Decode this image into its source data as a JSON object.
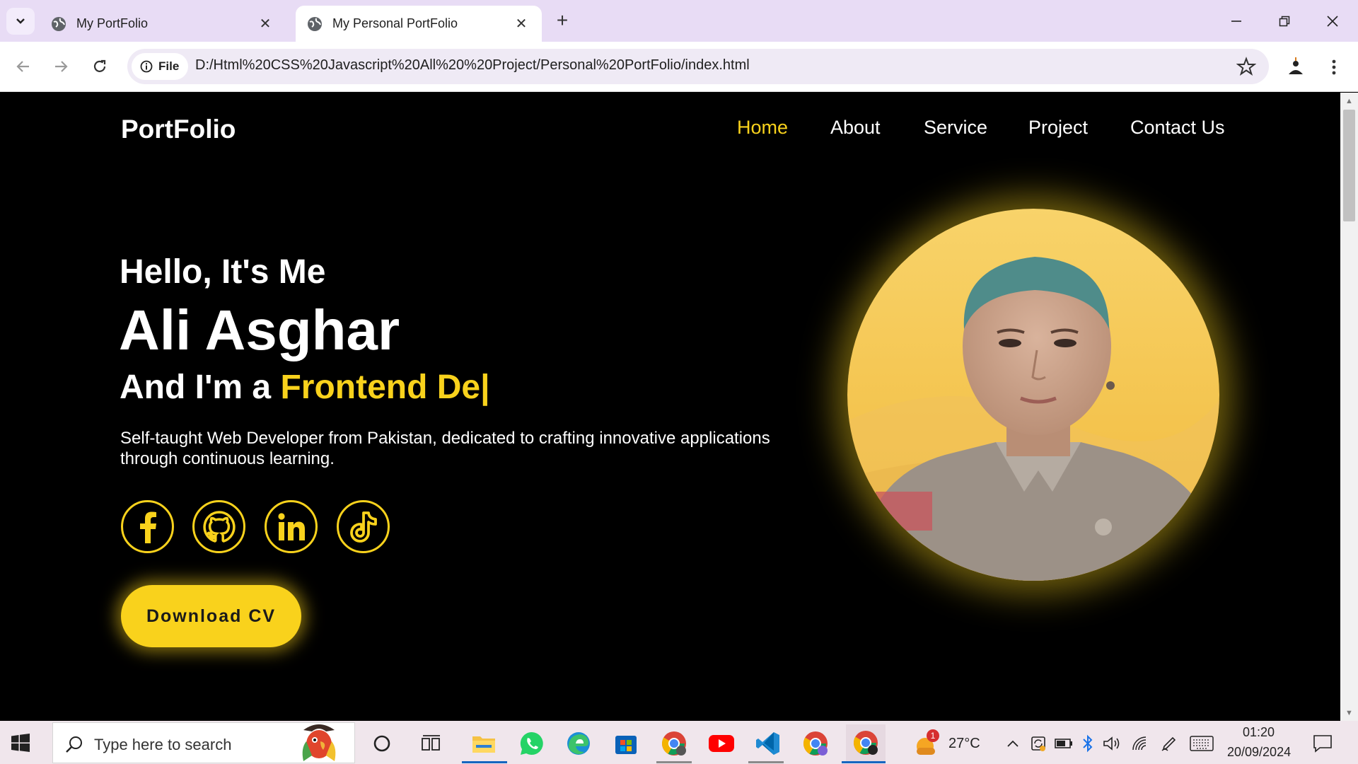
{
  "browser": {
    "tabs": [
      {
        "title": "My PortFolio",
        "active": false
      },
      {
        "title": "My Personal PortFolio",
        "active": true
      }
    ],
    "site_info_label": "File",
    "url": "D:/Html%20CSS%20Javascript%20All%20%20Project/Personal%20PortFolio/index.html"
  },
  "site": {
    "logo": "PortFolio",
    "nav": [
      "Home",
      "About",
      "Service",
      "Project",
      "Contact Us"
    ],
    "active_nav": "Home",
    "greeting": "Hello, It's Me",
    "name": "Ali Asghar",
    "role_prefix": "And I'm a ",
    "role_typed": "Frontend De|",
    "description": "Self-taught Web Developer from Pakistan, dedicated to crafting innovative applications through continuous learning.",
    "socials": [
      "facebook-icon",
      "github-icon",
      "linkedin-icon",
      "tiktok-icon"
    ],
    "cta": "Download CV",
    "accent_color": "#f9d21c"
  },
  "taskbar": {
    "search_placeholder": "Type here to search",
    "weather_badge": "1",
    "temperature": "27°C",
    "time": "01:20",
    "date": "20/09/2024"
  }
}
